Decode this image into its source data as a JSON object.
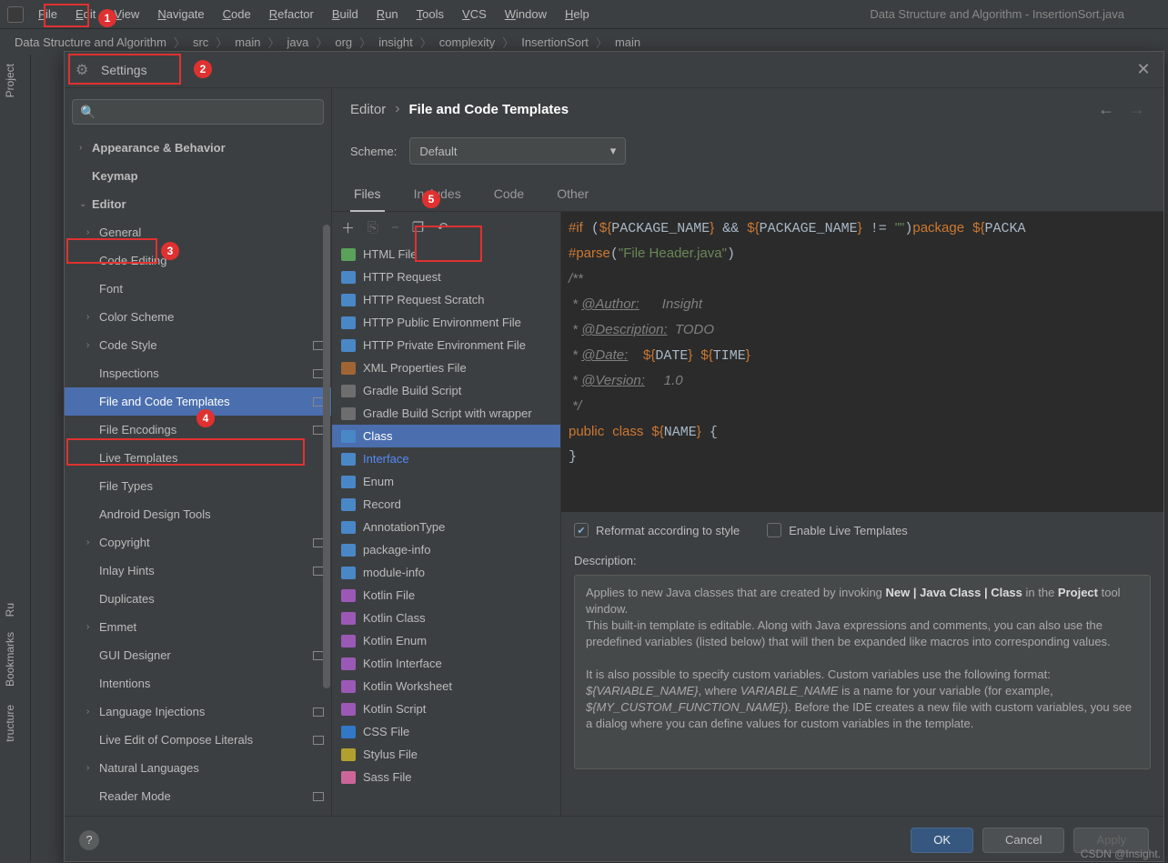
{
  "menubar": [
    "File",
    "Edit",
    "View",
    "Navigate",
    "Code",
    "Refactor",
    "Build",
    "Run",
    "Tools",
    "VCS",
    "Window",
    "Help"
  ],
  "title_path": "Data Structure and Algorithm - InsertionSort.java",
  "breadcrumb": [
    "Data Structure and Algorithm",
    "src",
    "main",
    "java",
    "org",
    "insight",
    "complexity",
    "InsertionSort",
    "main"
  ],
  "side_tabs": {
    "project": "Project",
    "bookmarks": "Bookmarks",
    "structure": "tructure",
    "run": "Ru"
  },
  "dialog": {
    "title": "Settings",
    "search_placeholder": "",
    "crumb": {
      "parent": "Editor",
      "current": "File and Code Templates"
    },
    "scheme_label": "Scheme:",
    "scheme_value": "Default",
    "tabs": [
      "Files",
      "Includes",
      "Code",
      "Other"
    ],
    "active_tab": 0,
    "tree": [
      {
        "lbl": "Appearance & Behavior",
        "lvl": 0,
        "chev": ">",
        "bold": true
      },
      {
        "lbl": "Keymap",
        "lvl": 0,
        "bold": true
      },
      {
        "lbl": "Editor",
        "lvl": 0,
        "chev": "v",
        "bold": true
      },
      {
        "lbl": "General",
        "lvl": 1,
        "chev": ">"
      },
      {
        "lbl": "Code Editing",
        "lvl": 1
      },
      {
        "lbl": "Font",
        "lvl": 1
      },
      {
        "lbl": "Color Scheme",
        "lvl": 1,
        "chev": ">"
      },
      {
        "lbl": "Code Style",
        "lvl": 1,
        "chev": ">",
        "badge": true
      },
      {
        "lbl": "Inspections",
        "lvl": 1,
        "badge": true
      },
      {
        "lbl": "File and Code Templates",
        "lvl": 1,
        "selected": true,
        "badge": true
      },
      {
        "lbl": "File Encodings",
        "lvl": 1,
        "badge": true
      },
      {
        "lbl": "Live Templates",
        "lvl": 1
      },
      {
        "lbl": "File Types",
        "lvl": 1
      },
      {
        "lbl": "Android Design Tools",
        "lvl": 1
      },
      {
        "lbl": "Copyright",
        "lvl": 1,
        "chev": ">",
        "badge": true
      },
      {
        "lbl": "Inlay Hints",
        "lvl": 1,
        "badge": true
      },
      {
        "lbl": "Duplicates",
        "lvl": 1
      },
      {
        "lbl": "Emmet",
        "lvl": 1,
        "chev": ">"
      },
      {
        "lbl": "GUI Designer",
        "lvl": 1,
        "badge": true
      },
      {
        "lbl": "Intentions",
        "lvl": 1
      },
      {
        "lbl": "Language Injections",
        "lvl": 1,
        "chev": ">",
        "badge": true
      },
      {
        "lbl": "Live Edit of Compose Literals",
        "lvl": 1,
        "badge": true
      },
      {
        "lbl": "Natural Languages",
        "lvl": 1,
        "chev": ">"
      },
      {
        "lbl": "Reader Mode",
        "lvl": 1,
        "badge": true
      }
    ],
    "templates": [
      {
        "name": "HTML File",
        "color": "#5aa15a"
      },
      {
        "name": "HTTP Request",
        "color": "#4a87c7"
      },
      {
        "name": "HTTP Request Scratch",
        "color": "#4a87c7"
      },
      {
        "name": "HTTP Public Environment File",
        "color": "#4a87c7"
      },
      {
        "name": "HTTP Private Environment File",
        "color": "#4a87c7"
      },
      {
        "name": "XML Properties File",
        "color": "#a06535"
      },
      {
        "name": "Gradle Build Script",
        "color": "#6e6e6e"
      },
      {
        "name": "Gradle Build Script with wrapper",
        "color": "#6e6e6e"
      },
      {
        "name": "Class",
        "color": "#4a87c7",
        "selected": true
      },
      {
        "name": "Interface",
        "color": "#4a87c7",
        "link": true
      },
      {
        "name": "Enum",
        "color": "#4a87c7"
      },
      {
        "name": "Record",
        "color": "#4a87c7"
      },
      {
        "name": "AnnotationType",
        "color": "#4a87c7"
      },
      {
        "name": "package-info",
        "color": "#4a87c7"
      },
      {
        "name": "module-info",
        "color": "#4a87c7"
      },
      {
        "name": "Kotlin File",
        "color": "#9b59b6"
      },
      {
        "name": "Kotlin Class",
        "color": "#9b59b6"
      },
      {
        "name": "Kotlin Enum",
        "color": "#9b59b6"
      },
      {
        "name": "Kotlin Interface",
        "color": "#9b59b6"
      },
      {
        "name": "Kotlin Worksheet",
        "color": "#9b59b6"
      },
      {
        "name": "Kotlin Script",
        "color": "#9b59b6"
      },
      {
        "name": "CSS File",
        "color": "#3178c6"
      },
      {
        "name": "Stylus File",
        "color": "#b0a030"
      },
      {
        "name": "Sass File",
        "color": "#cc6699"
      }
    ],
    "code_lines": [
      {
        "html": "<span class='kw'>#if</span> (<span class='var'>${</span>PACKAGE_NAME<span class='var'>}</span> && <span class='var'>${</span>PACKAGE_NAME<span class='var'>}</span> != <span class='str'>\"\"</span>)<span class='kw'>package</span> <span class='var'>${</span>PACKA"
      },
      {
        "html": "<span class='kw'>#parse</span>(<span class='str'>\"File Header.java\"</span>)"
      },
      {
        "html": "<span class='cmt'>/**</span>"
      },
      {
        "html": "<span class='cmt'> * <span class='tag'>@Author:</span>      Insight</span>"
      },
      {
        "html": "<span class='cmt'> * <span class='tag'>@Description:</span>  TODO</span>"
      },
      {
        "html": "<span class='cmt'> * <span class='tag'>@Date:</span>    </span><span class='var'>${</span>DATE<span class='var'>}</span> <span class='var'>${</span>TIME<span class='var'>}</span>"
      },
      {
        "html": "<span class='cmt'> * <span class='tag'>@Version:</span>     1.0</span>"
      },
      {
        "html": "<span class='cmt'> */</span>"
      },
      {
        "html": "<span class='kw'>public</span> <span class='kw'>class</span> <span class='var'>${</span>NAME<span class='var'>}</span> {"
      },
      {
        "html": "}"
      }
    ],
    "checks": {
      "reformat": "Reformat according to style",
      "reformat_on": true,
      "live": "Enable Live Templates",
      "live_on": false
    },
    "desc_label": "Description:",
    "desc_html": "Applies to new Java classes that are created by invoking <b>New | Java Class | Class</b> in the <b>Project</b> tool window.<br>This built-in template is editable. Along with Java expressions and comments, you can also use the predefined variables (listed below) that will then be expanded like macros into corresponding values.<br><br>It is also possible to specify custom variables. Custom variables use the following format: <i>${VARIABLE_NAME}</i>, where <i>VARIABLE_NAME</i> is a name for your variable (for example, <i>${MY_CUSTOM_FUNCTION_NAME}</i>). Before the IDE creates a new file with custom variables, you see a dialog where you can define values for custom variables in the template.",
    "buttons": {
      "ok": "OK",
      "cancel": "Cancel",
      "apply": "Apply"
    }
  },
  "watermark": "CSDN @Insight."
}
